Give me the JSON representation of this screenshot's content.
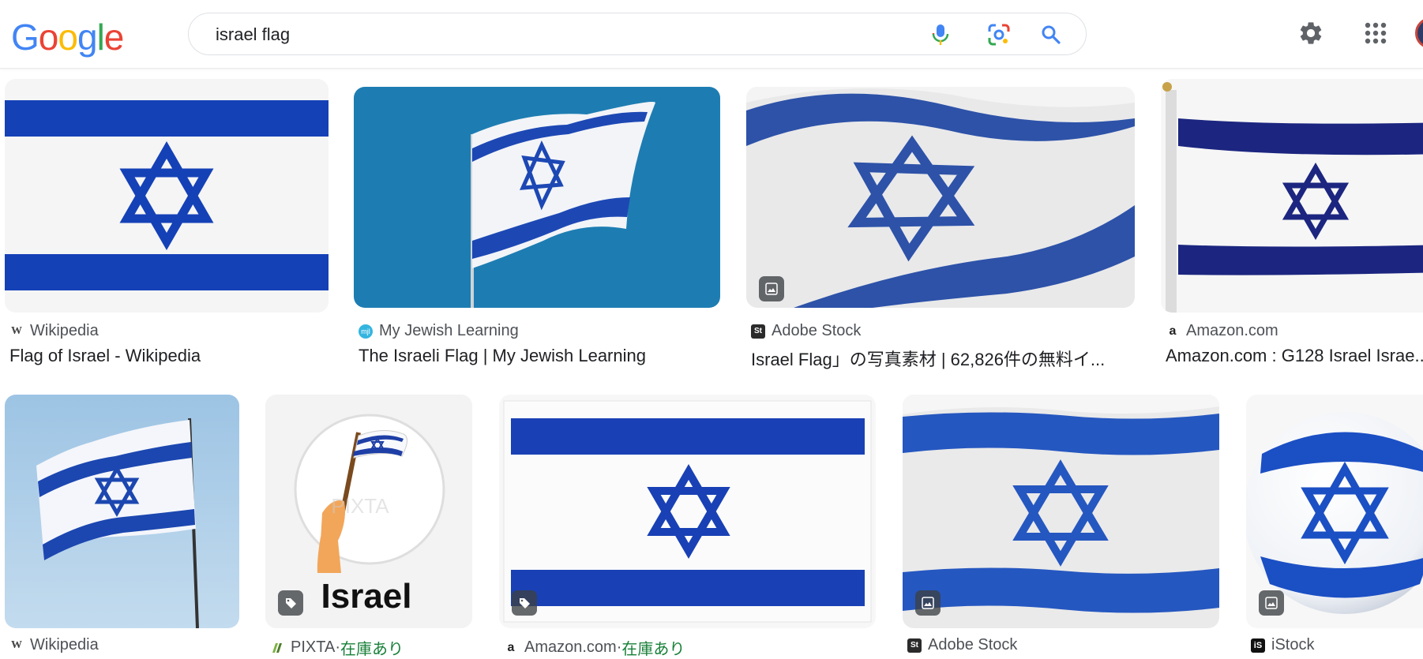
{
  "search": {
    "query": "israel flag"
  },
  "logo": {
    "letters": [
      "G",
      "o",
      "o",
      "g",
      "l",
      "e"
    ]
  },
  "colors": {
    "flag_blue": "#1747b5",
    "wiki_blue": "#0038b8",
    "sky": "#1e7eb3"
  },
  "row1": [
    {
      "source": "Wikipedia",
      "title": "Flag of Israel - Wikipedia"
    },
    {
      "source": "My Jewish Learning",
      "title": "The Israeli Flag | My Jewish Learning"
    },
    {
      "source": "Adobe Stock",
      "title": "Israel Flag」の写真素材 | 62,826件の無料イ..."
    },
    {
      "source": "Amazon.com",
      "title": "Amazon.com : G128 Israel Israe..."
    }
  ],
  "row2": [
    {
      "source": "Wikipedia",
      "stock": ""
    },
    {
      "source": "PIXTA",
      "stock": "在庫あり",
      "image_text": "Israel",
      "watermark": "PIXTA"
    },
    {
      "source": "Amazon.com",
      "stock": "在庫あり"
    },
    {
      "source": "Adobe Stock",
      "stock": ""
    },
    {
      "source": "iStock",
      "stock": ""
    }
  ],
  "separator": " · "
}
